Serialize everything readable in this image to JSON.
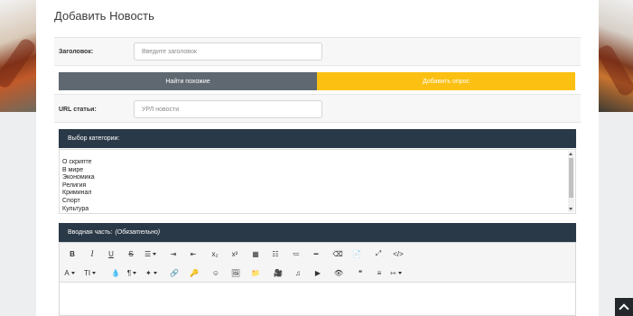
{
  "page_title": "Добавить Новость",
  "title_field": {
    "label": "Заголовок:",
    "placeholder": "Введите заголовок",
    "value": ""
  },
  "buttons": {
    "find_similar": "Найти похожие",
    "add_poll": "Добавить опрос"
  },
  "url_field": {
    "label": "URL статьи:",
    "placeholder": "УРЛ новости",
    "value": ""
  },
  "category": {
    "header": "Выбор категории:",
    "options": [
      "О скрипте",
      "В мире",
      "Экономика",
      "Религия",
      "Криминал",
      "Спорт",
      "Культура"
    ]
  },
  "intro": {
    "header": "Вводная часть:",
    "header_note": "(Обязательно)"
  },
  "toolbar": {
    "row1": [
      {
        "name": "bold-button",
        "glyph": "B",
        "style": "b"
      },
      {
        "name": "italic-button",
        "glyph": "I",
        "style": "i"
      },
      {
        "name": "underline-button",
        "glyph": "U",
        "style": "u"
      },
      {
        "name": "strikethrough-button",
        "glyph": "S",
        "style": "s"
      },
      {
        "name": "align-dropdown",
        "glyph": "☰",
        "caret": true
      },
      {
        "name": "indent-button",
        "glyph": "⇥"
      },
      {
        "name": "outdent-button",
        "glyph": "⇤"
      },
      {
        "name": "subscript-button",
        "glyph": "x₂"
      },
      {
        "name": "superscript-button",
        "glyph": "x²"
      },
      {
        "name": "table-button",
        "glyph": "▦"
      },
      {
        "name": "unordered-list-button",
        "glyph": "☷"
      },
      {
        "name": "ordered-list-button",
        "glyph": "≔"
      },
      {
        "name": "horizontal-line-button",
        "glyph": "━"
      },
      {
        "name": "clear-format-button",
        "glyph": "⌫"
      },
      {
        "name": "paste-text-button",
        "glyph": "📄"
      },
      {
        "name": "fullscreen-button",
        "glyph": "⤢"
      },
      {
        "name": "code-view-button",
        "glyph": "</>"
      }
    ],
    "row2": [
      {
        "name": "font-color-dropdown",
        "glyph": "A",
        "caret": true
      },
      {
        "name": "font-size-dropdown",
        "glyph": "TI",
        "caret": true
      },
      {
        "name": "fill-color-button",
        "glyph": "💧"
      },
      {
        "name": "paragraph-dropdown",
        "glyph": "¶",
        "caret": true
      },
      {
        "name": "magic-format-dropdown",
        "glyph": "✦",
        "caret": true
      },
      {
        "name": "link-button",
        "glyph": "🔗"
      },
      {
        "name": "spoiler-key-button",
        "glyph": "🔑"
      },
      {
        "name": "emoji-button",
        "glyph": "☺"
      },
      {
        "name": "image-button",
        "glyph": "🖼"
      },
      {
        "name": "folder-button",
        "glyph": "📁"
      },
      {
        "name": "video-button",
        "glyph": "🎥"
      },
      {
        "name": "audio-button",
        "glyph": "♫"
      },
      {
        "name": "youtube-button",
        "glyph": "▶"
      },
      {
        "name": "hide-button",
        "glyph": "👁"
      },
      {
        "name": "quote-button",
        "glyph": "❝"
      },
      {
        "name": "align-justify-button",
        "glyph": "≡"
      },
      {
        "name": "page-break-dropdown",
        "glyph": "⇿",
        "caret": true
      }
    ]
  }
}
